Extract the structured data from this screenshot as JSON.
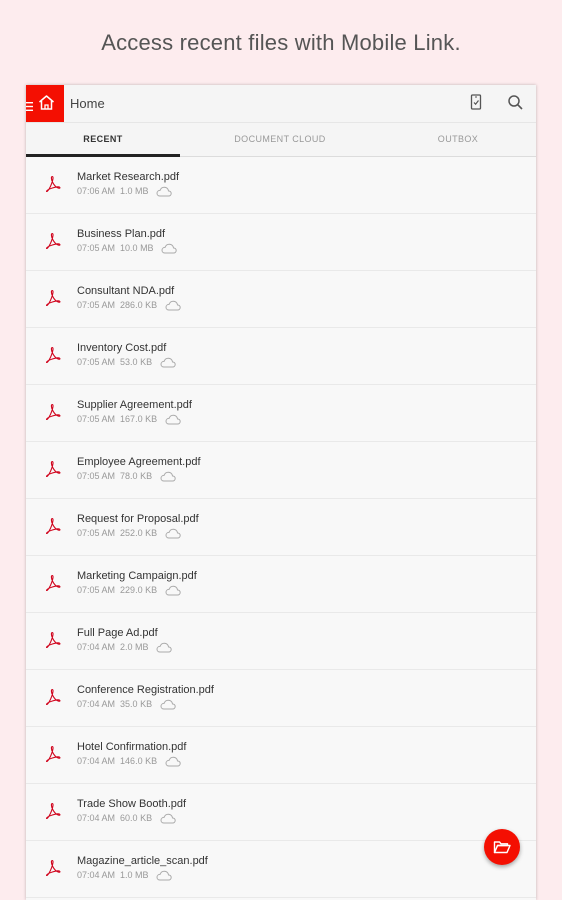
{
  "headline": "Access recent files with Mobile Link.",
  "topbar": {
    "title": "Home",
    "icons": [
      "menu-icon",
      "home-icon",
      "mobile-link-icon",
      "search-icon"
    ],
    "accent_color": "#f40f02"
  },
  "tabs": [
    {
      "label": "RECENT",
      "active": true
    },
    {
      "label": "DOCUMENT CLOUD",
      "active": false
    },
    {
      "label": "OUTBOX",
      "active": false
    }
  ],
  "files": [
    {
      "name": "Market Research.pdf",
      "time": "07:06 AM",
      "size": "1.0 MB"
    },
    {
      "name": "Business Plan.pdf",
      "time": "07:05 AM",
      "size": "10.0 MB"
    },
    {
      "name": "Consultant NDA.pdf",
      "time": "07:05 AM",
      "size": "286.0 KB"
    },
    {
      "name": "Inventory Cost.pdf",
      "time": "07:05 AM",
      "size": "53.0 KB"
    },
    {
      "name": "Supplier Agreement.pdf",
      "time": "07:05 AM",
      "size": "167.0 KB"
    },
    {
      "name": "Employee Agreement.pdf",
      "time": "07:05 AM",
      "size": "78.0 KB"
    },
    {
      "name": "Request for Proposal.pdf",
      "time": "07:05 AM",
      "size": "252.0 KB"
    },
    {
      "name": "Marketing Campaign.pdf",
      "time": "07:05 AM",
      "size": "229.0 KB"
    },
    {
      "name": "Full Page Ad.pdf",
      "time": "07:04 AM",
      "size": "2.0 MB"
    },
    {
      "name": "Conference Registration.pdf",
      "time": "07:04 AM",
      "size": "35.0 KB"
    },
    {
      "name": "Hotel Confirmation.pdf",
      "time": "07:04 AM",
      "size": "146.0 KB"
    },
    {
      "name": "Trade Show Booth.pdf",
      "time": "07:04 AM",
      "size": "60.0 KB"
    },
    {
      "name": "Magazine_article_scan.pdf",
      "time": "07:04 AM",
      "size": "1.0 MB"
    }
  ],
  "fab": {
    "icon": "open-folder-icon"
  }
}
